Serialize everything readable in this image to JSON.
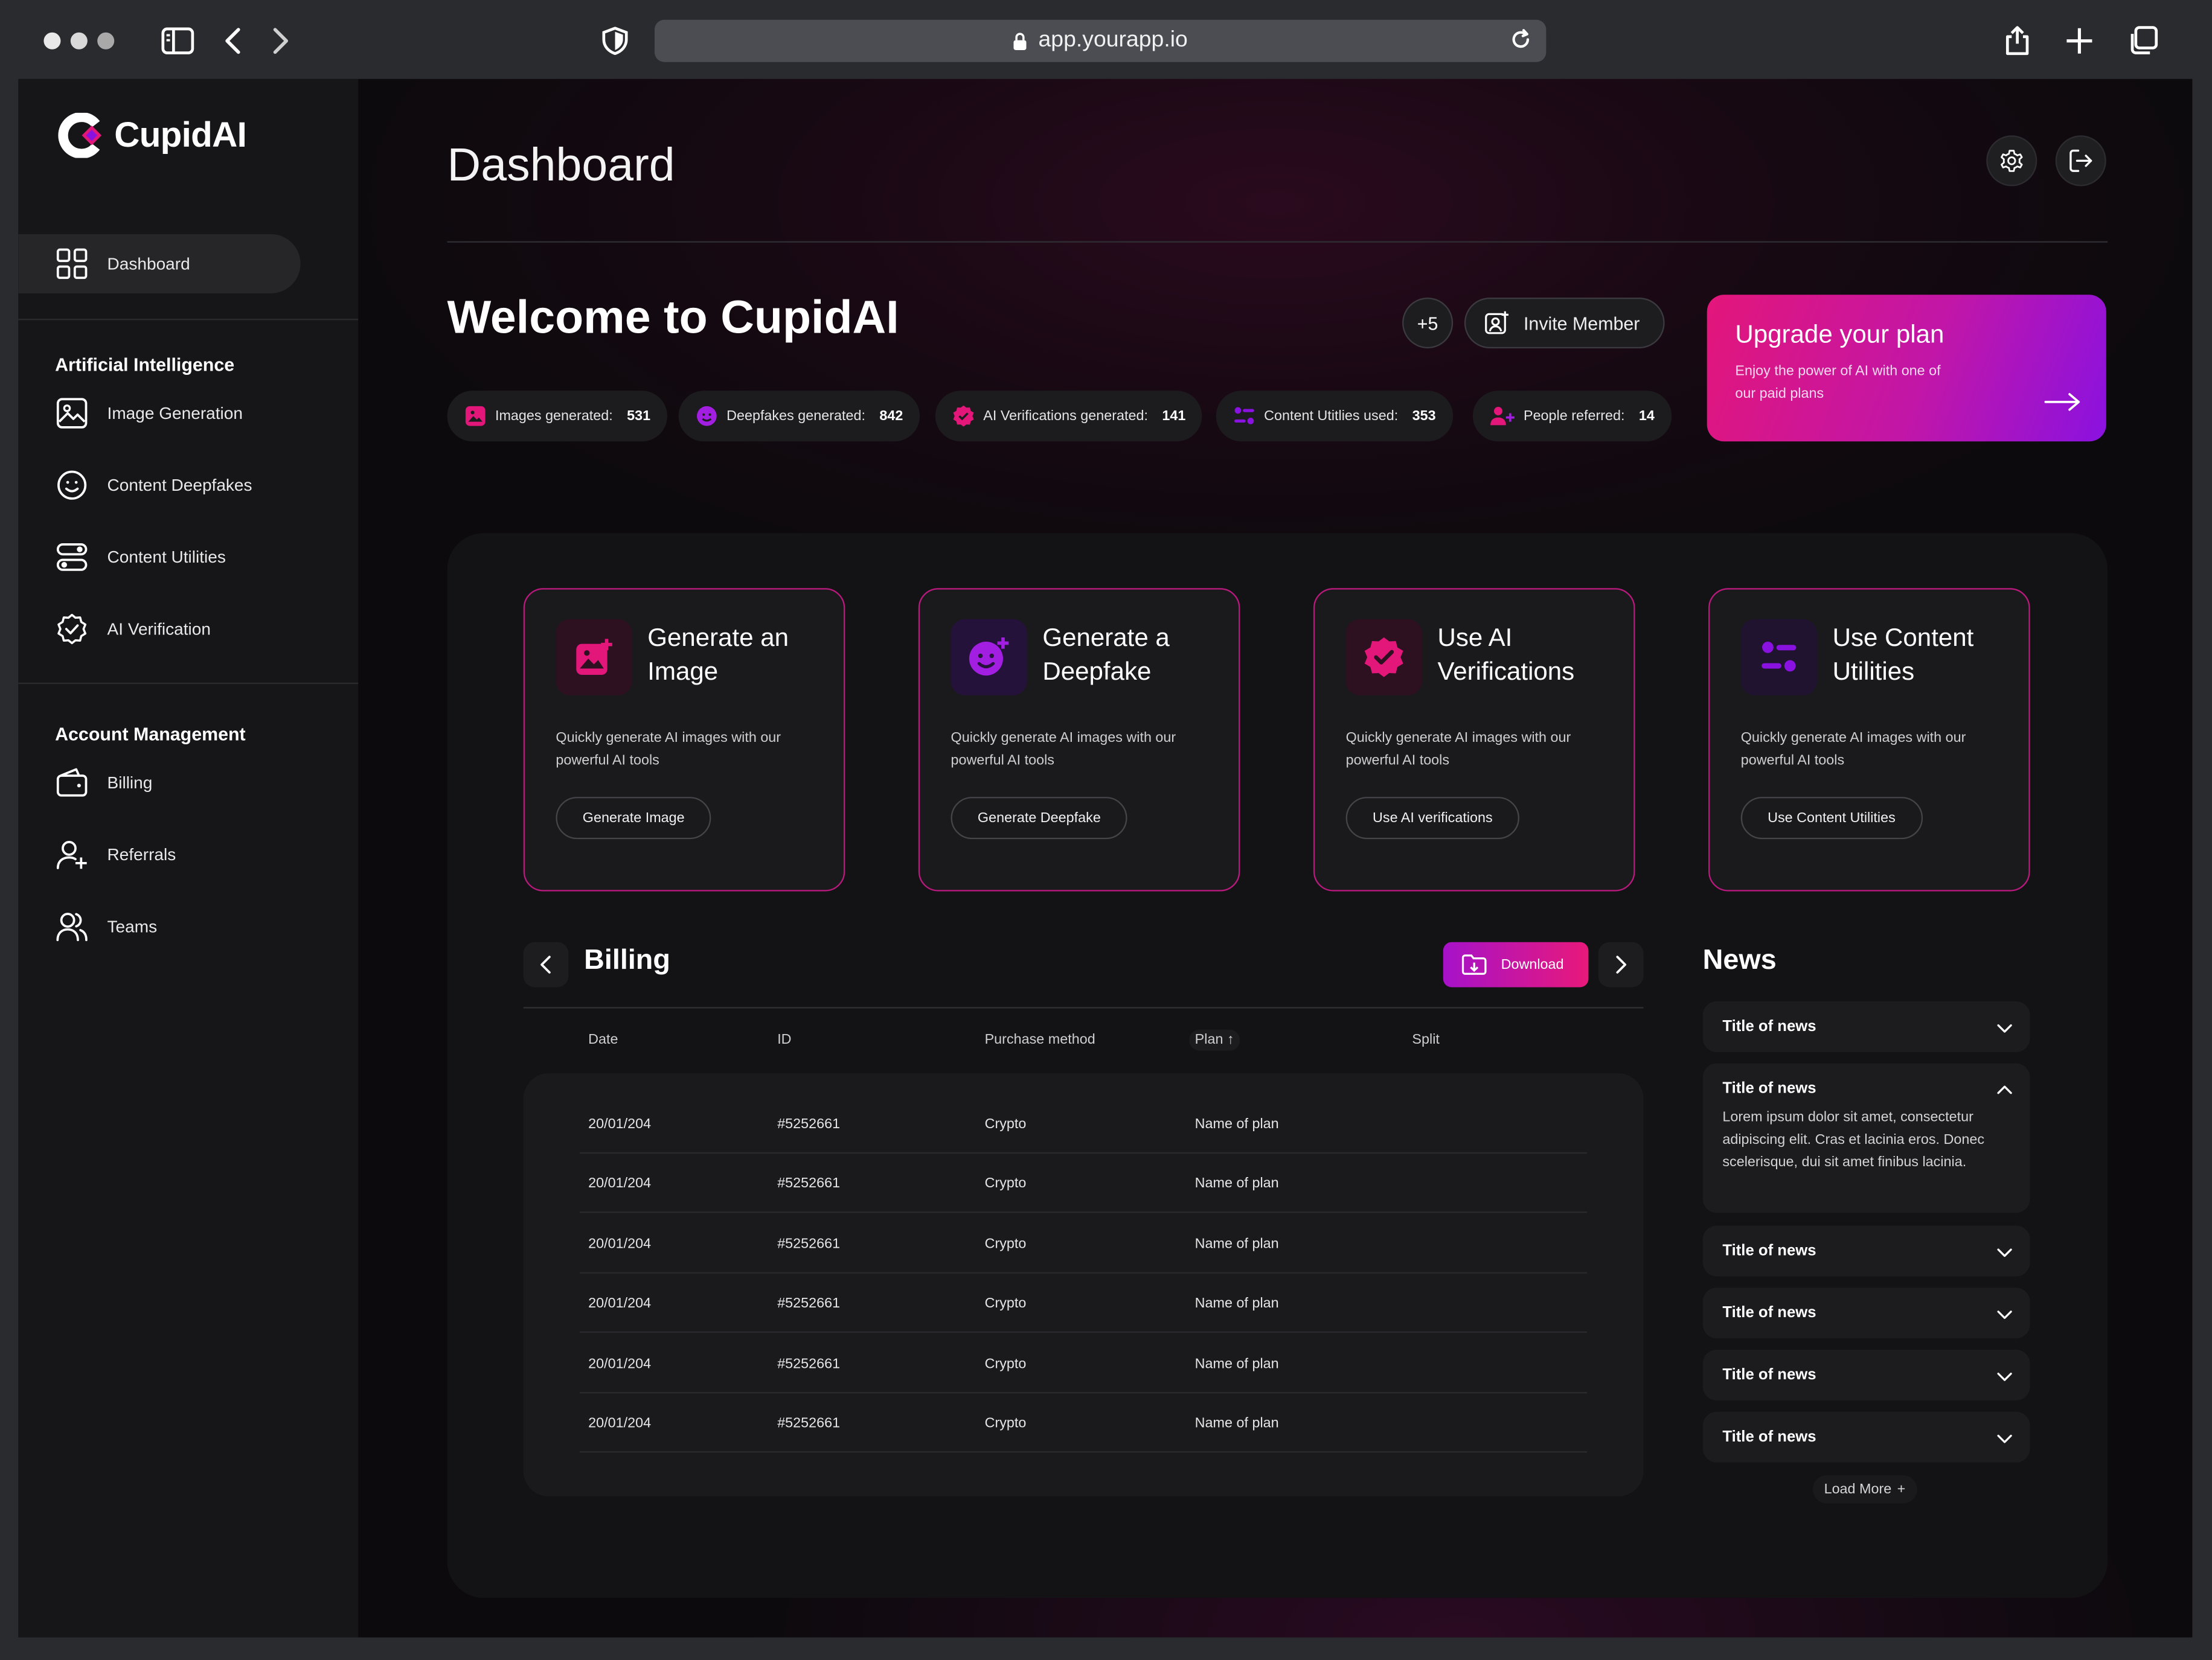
{
  "browser": {
    "url": "app.yourapp.io"
  },
  "brand": {
    "name": "CupidAI"
  },
  "sidebar": {
    "dashboard": "Dashboard",
    "sections": [
      {
        "title": "Artificial Intelligence",
        "items": [
          "Image Generation",
          "Content Deepfakes",
          "Content Utilities",
          "AI Verification"
        ]
      },
      {
        "title": "Account Management",
        "items": [
          "Billing",
          "Referrals",
          "Teams"
        ]
      }
    ]
  },
  "header": {
    "title": "Dashboard"
  },
  "welcome": {
    "title": "Welcome to CupidAI",
    "member_count": "+5",
    "invite_label": "Invite Member"
  },
  "stats": [
    {
      "label": "Images generated:",
      "value": "531"
    },
    {
      "label": "Deepfakes generated:",
      "value": "842"
    },
    {
      "label": "AI Verifications generated:",
      "value": "141"
    },
    {
      "label": "Content Utitlies used:",
      "value": "353"
    },
    {
      "label": "People referred:",
      "value": "14"
    }
  ],
  "upgrade": {
    "title": "Upgrade your plan",
    "subtitle": "Enjoy the power of AI with one of our paid plans"
  },
  "cards": [
    {
      "title": "Generate an Image",
      "desc": "Quickly generate AI images with our powerful AI tools",
      "button": "Generate Image"
    },
    {
      "title": "Generate a Deepfake",
      "desc": "Quickly generate AI images with our powerful AI tools",
      "button": "Generate Deepfake"
    },
    {
      "title": "Use AI Verifications",
      "desc": "Quickly generate AI images with our powerful AI tools",
      "button": "Use AI verifications"
    },
    {
      "title": "Use Content Utilities",
      "desc": "Quickly generate AI images with our powerful AI tools",
      "button": "Use Content Utilities"
    }
  ],
  "billing": {
    "title": "Billing",
    "download_label": "Download",
    "columns": [
      "Date",
      "ID",
      "Purchase method",
      "Plan",
      "Split"
    ],
    "sort_indicator": "↑",
    "rows": [
      {
        "date": "20/01/204",
        "id": "#5252661",
        "method": "Crypto",
        "plan": "Name of plan"
      },
      {
        "date": "20/01/204",
        "id": "#5252661",
        "method": "Crypto",
        "plan": "Name of plan"
      },
      {
        "date": "20/01/204",
        "id": "#5252661",
        "method": "Crypto",
        "plan": "Name of plan"
      },
      {
        "date": "20/01/204",
        "id": "#5252661",
        "method": "Crypto",
        "plan": "Name of plan"
      },
      {
        "date": "20/01/204",
        "id": "#5252661",
        "method": "Crypto",
        "plan": "Name of plan"
      },
      {
        "date": "20/01/204",
        "id": "#5252661",
        "method": "Crypto",
        "plan": "Name of plan"
      }
    ]
  },
  "news": {
    "title": "News",
    "items": [
      {
        "title": "Title of news",
        "expanded": false
      },
      {
        "title": "Title of news",
        "expanded": true,
        "body": "Lorem ipsum dolor sit amet, consectetur adipiscing elit. Cras et lacinia eros. Donec scelerisque, dui sit amet finibus lacinia."
      },
      {
        "title": "Title of news",
        "expanded": false
      },
      {
        "title": "Title of news",
        "expanded": false
      },
      {
        "title": "Title of news",
        "expanded": false
      },
      {
        "title": "Title of news",
        "expanded": false
      }
    ],
    "load_more": "Load More",
    "load_more_icon": "+"
  },
  "colors": {
    "accent_pink": "#e3167a",
    "accent_purple": "#8a12e0",
    "card_border": "#b71a7c"
  }
}
